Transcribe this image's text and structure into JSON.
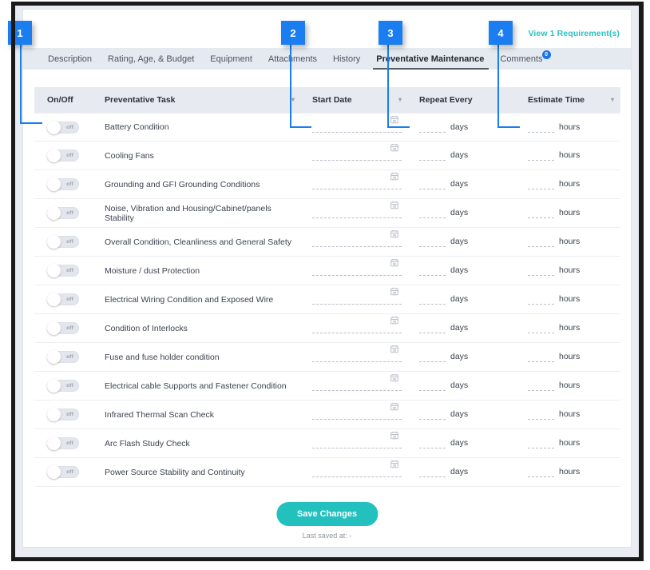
{
  "header": {
    "requirements_link": "View 1 Requirement(s)",
    "link_color": "#27c3c0"
  },
  "tabs": [
    {
      "label": "Description",
      "active": false
    },
    {
      "label": "Rating, Age, & Budget",
      "active": false
    },
    {
      "label": "Equipment",
      "active": false
    },
    {
      "label": "Attachments",
      "active": false
    },
    {
      "label": "History",
      "active": false
    },
    {
      "label": "Preventative Maintenance",
      "active": true
    },
    {
      "label": "Comments",
      "active": false,
      "badge": "0"
    }
  ],
  "table": {
    "columns": [
      {
        "label": "On/Off",
        "sortable": false
      },
      {
        "label": "Preventative Task",
        "sortable": true
      },
      {
        "label": "Start Date",
        "sortable": true
      },
      {
        "label": "Repeat Every",
        "sortable": false
      },
      {
        "label": "Estimate Time",
        "sortable": true
      }
    ],
    "toggle_off_label": "off",
    "repeat_unit": "days",
    "estimate_unit": "hours",
    "date_placeholder": "",
    "repeat_value": "",
    "estimate_value": "",
    "rows": [
      {
        "task": "Battery Condition",
        "toggle": "off"
      },
      {
        "task": "Cooling Fans",
        "toggle": "off"
      },
      {
        "task": "Grounding and GFI Grounding Conditions",
        "toggle": "off"
      },
      {
        "task": "Noise, Vibration and Housing/Cabinet/panels Stability",
        "toggle": "off"
      },
      {
        "task": "Overall Condition, Cleanliness and General Safety",
        "toggle": "off"
      },
      {
        "task": "Moisture / dust Protection",
        "toggle": "off"
      },
      {
        "task": "Electrical Wiring Condition and Exposed Wire",
        "toggle": "off"
      },
      {
        "task": "Condition of Interlocks",
        "toggle": "off"
      },
      {
        "task": "Fuse and fuse holder condition",
        "toggle": "off"
      },
      {
        "task": "Electrical cable Supports and Fastener Condition",
        "toggle": "off"
      },
      {
        "task": "Infrared Thermal Scan Check",
        "toggle": "off"
      },
      {
        "task": "Arc Flash Study Check",
        "toggle": "off"
      },
      {
        "task": "Power Source Stability and Continuity",
        "toggle": "off"
      }
    ]
  },
  "footer": {
    "save_label": "Save Changes",
    "last_saved": "Last saved at: -",
    "save_color": "#22c1be"
  },
  "callouts": [
    {
      "number": "1"
    },
    {
      "number": "2"
    },
    {
      "number": "3"
    },
    {
      "number": "4"
    }
  ]
}
